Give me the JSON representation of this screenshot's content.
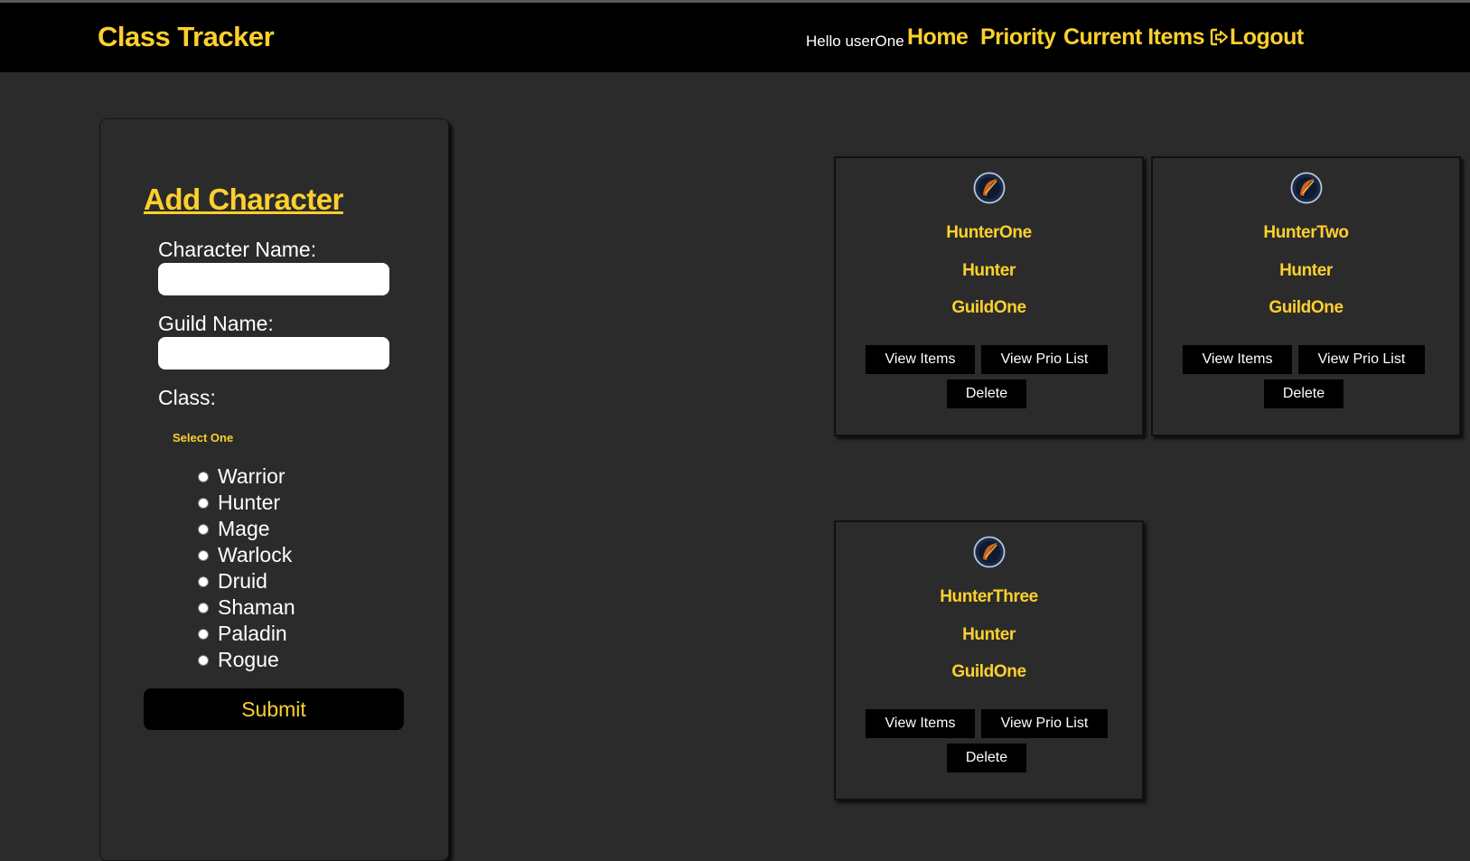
{
  "nav": {
    "brand": "Class Tracker",
    "greeting": "Hello userOne",
    "links": [
      "Home",
      "Priority",
      "Current Items",
      "Logout"
    ]
  },
  "form": {
    "title": "Add Character",
    "character_name_label": "Character Name:",
    "character_name_value": "",
    "guild_name_label": "Guild Name:",
    "guild_name_value": "",
    "class_label": "Class:",
    "select_prompt": "Select One",
    "classes": [
      "Warrior",
      "Hunter",
      "Mage",
      "Warlock",
      "Druid",
      "Shaman",
      "Paladin",
      "Rogue"
    ],
    "submit_label": "Submit"
  },
  "characters": [
    {
      "name": "HunterOne",
      "class": "Hunter",
      "guild": "GuildOne",
      "icon": "hunter-class-icon"
    },
    {
      "name": "HunterTwo",
      "class": "Hunter",
      "guild": "GuildOne",
      "icon": "hunter-class-icon"
    },
    {
      "name": "HunterThree",
      "class": "Hunter",
      "guild": "GuildOne",
      "icon": "hunter-class-icon"
    }
  ],
  "card_buttons": {
    "view_items": "View Items",
    "view_prio": "View Prio List",
    "delete": "Delete"
  },
  "colors": {
    "accent": "#fdd02c",
    "background": "#2b2b2b",
    "navbar": "#000000"
  }
}
